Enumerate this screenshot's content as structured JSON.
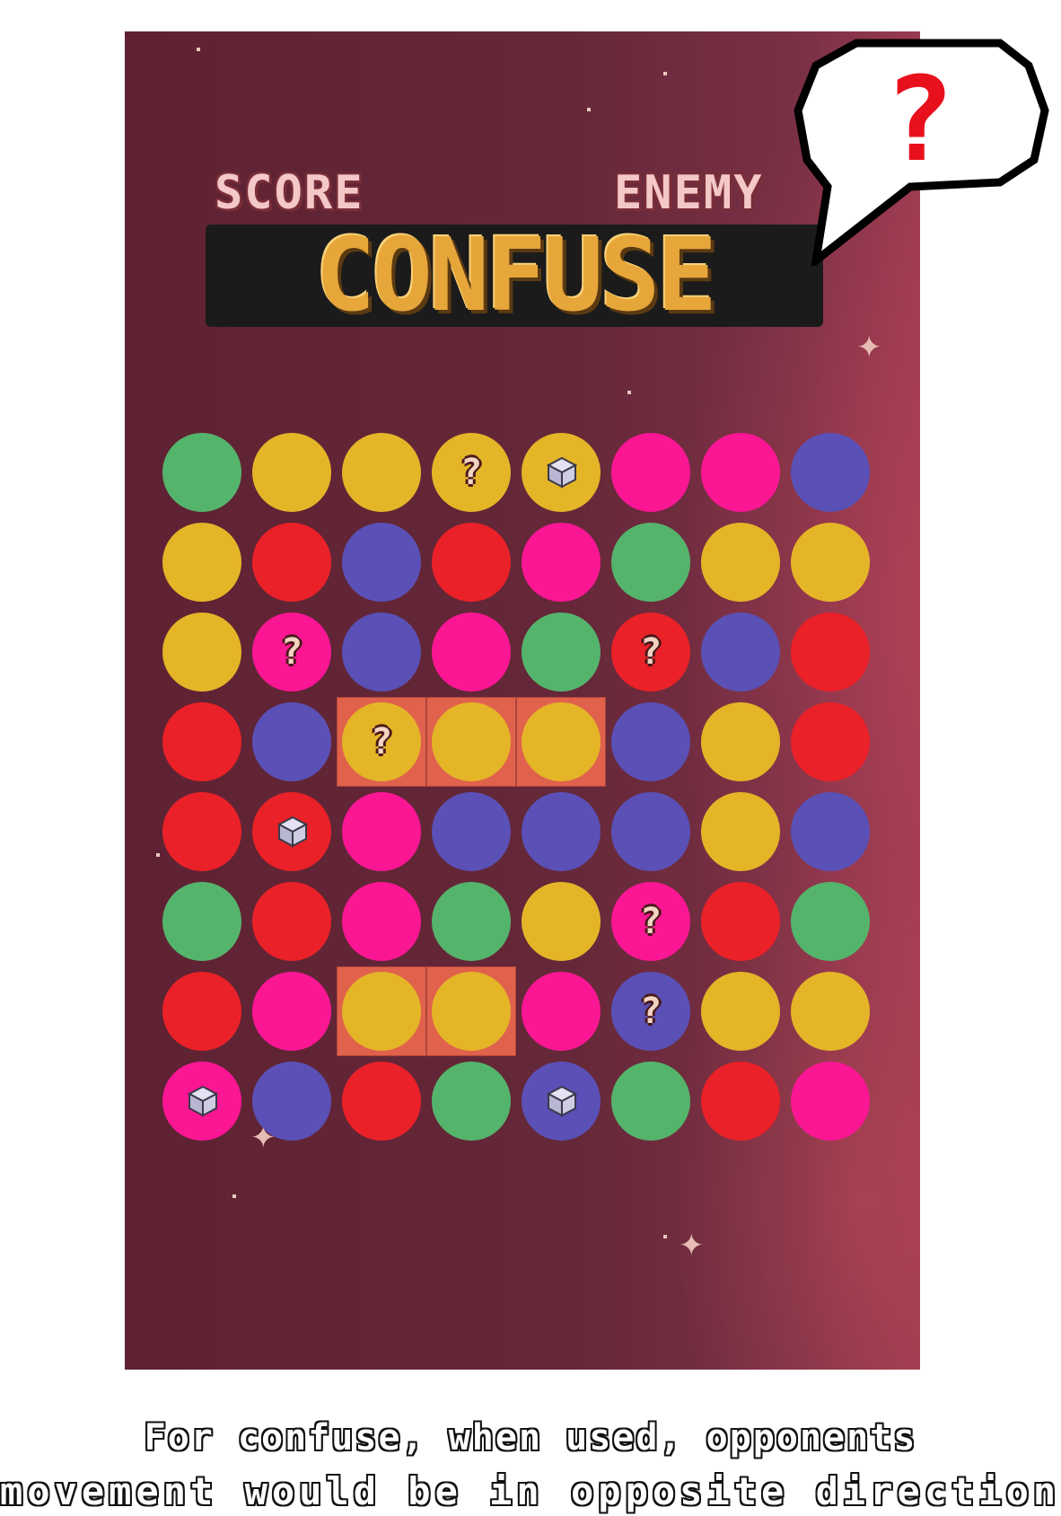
{
  "hud": {
    "score_label": "SCORE",
    "enemy_label": "ENEMY",
    "power_title": "CONFUSE"
  },
  "bubble": {
    "symbol": "?"
  },
  "caption": {
    "line1": "For confuse, when used, opponents",
    "line2": "movement would be in opposite direction."
  },
  "colors": {
    "green": "#55b46c",
    "yellow": "#e5b528",
    "pink": "#fb1694",
    "blue": "#5a50b6",
    "red": "#ea2128",
    "highlight": "#e0624c",
    "background": "#652838"
  },
  "board": {
    "rows": [
      [
        "green",
        "yellow",
        "yellow",
        "yellow",
        "yellow",
        "pink",
        "pink",
        "blue"
      ],
      [
        "yellow",
        "red",
        "blue",
        "red",
        "pink",
        "green",
        "yellow",
        "yellow"
      ],
      [
        "yellow",
        "pink",
        "blue",
        "pink",
        "green",
        "red",
        "blue",
        "red"
      ],
      [
        "red",
        "blue",
        "yellow",
        "yellow",
        "yellow",
        "blue",
        "yellow",
        "red"
      ],
      [
        "red",
        "red",
        "pink",
        "blue",
        "blue",
        "blue",
        "yellow",
        "blue"
      ],
      [
        "green",
        "red",
        "pink",
        "green",
        "yellow",
        "pink",
        "red",
        "green"
      ],
      [
        "red",
        "pink",
        "yellow",
        "yellow",
        "pink",
        "blue",
        "yellow",
        "yellow"
      ],
      [
        "pink",
        "blue",
        "red",
        "green",
        "blue",
        "green",
        "red",
        "pink"
      ]
    ],
    "confuse_items": [
      [
        0,
        3
      ],
      [
        2,
        1
      ],
      [
        2,
        5
      ],
      [
        3,
        2
      ],
      [
        5,
        5
      ],
      [
        6,
        5
      ]
    ],
    "cube_items": [
      [
        0,
        4
      ],
      [
        4,
        1
      ],
      [
        7,
        0
      ],
      [
        7,
        4
      ]
    ],
    "matched_groups": [
      {
        "row": 3,
        "cols": [
          2,
          3,
          4
        ]
      },
      {
        "row": 6,
        "cols": [
          2,
          3
        ]
      }
    ]
  }
}
